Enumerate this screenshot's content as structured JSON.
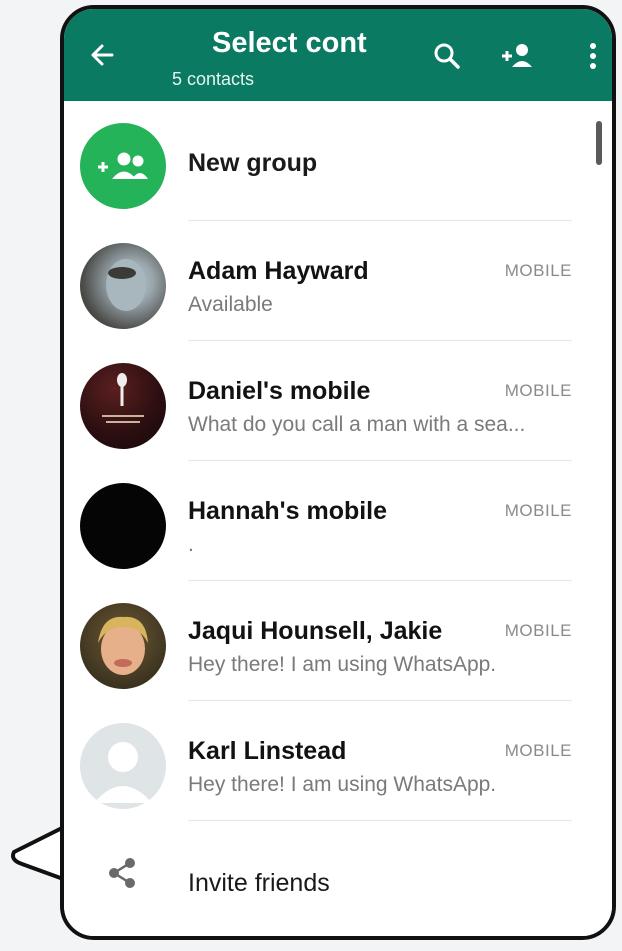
{
  "header": {
    "title": "Select cont",
    "subtitle": "5 contacts",
    "icons": [
      "back-arrow-icon",
      "search-icon",
      "add-contact-icon",
      "more-vert-icon"
    ],
    "color": "#0b7a63"
  },
  "new_group": {
    "label": "New group",
    "icon": "add-group-icon",
    "color": "#25b35a"
  },
  "contacts": [
    {
      "name": "Adam Hayward",
      "status": "Available",
      "type": "MOBILE"
    },
    {
      "name": "Daniel's mobile",
      "status": "What do you call a man with a sea...",
      "type": "MOBILE"
    },
    {
      "name": "Hannah's mobile",
      "status": ".",
      "type": "MOBILE"
    },
    {
      "name": "Jaqui Hounsell, Jakie",
      "status": "Hey there! I am using WhatsApp.",
      "type": "MOBILE"
    },
    {
      "name": "Karl Linstead",
      "status": "Hey there! I am using WhatsApp.",
      "type": "MOBILE"
    }
  ],
  "invite": {
    "label": "Invite friends",
    "icon": "share-icon"
  }
}
